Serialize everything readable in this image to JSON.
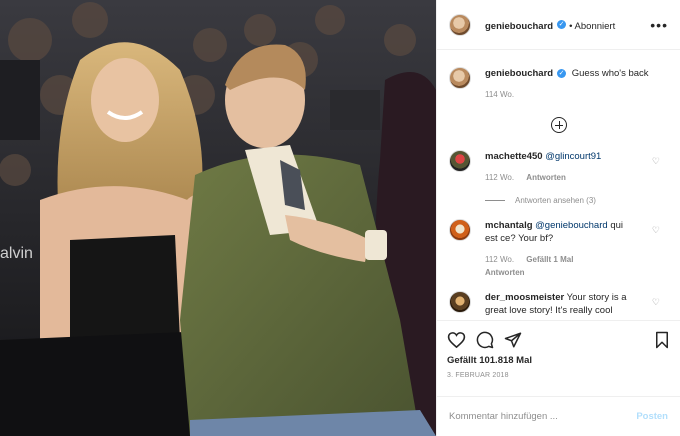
{
  "post": {
    "author": "geniebouchard",
    "follow_label": "Abonniert",
    "more_label": "•••",
    "caption_text": "Guess who's back",
    "caption_age": "114 Wo.",
    "likes": "Gefällt 101.818 Mal",
    "date": "3. FEBRUAR 2018",
    "verified_glyph": "✓",
    "photo_text": "alvin"
  },
  "comments": [
    {
      "user": "machette450",
      "mention": "@glincourt91",
      "text": "",
      "age": "112 Wo.",
      "reply_label": "Antworten",
      "likes": "",
      "view_replies": "Antworten ansehen (3)"
    },
    {
      "user": "mchantalg",
      "mention": "@geniebouchard",
      "text": "qui est ce? Your bf?",
      "age": "112 Wo.",
      "likes": "Gefällt 1 Mal",
      "reply_label": "Antworten"
    },
    {
      "user": "der_moosmeister",
      "mention": "",
      "text": "Your story is a great love story! It's really cool",
      "age": "",
      "likes": "",
      "reply_label": ""
    }
  ],
  "composer": {
    "placeholder": "Kommentar hinzufügen ...",
    "post_label": "Posten"
  },
  "icons": {
    "heart": "♡",
    "like": "heart-outline-icon",
    "comment": "comment-bubble-icon",
    "share": "paper-plane-icon",
    "save": "bookmark-icon",
    "add": "plus-circle-icon",
    "more": "ellipsis-icon"
  },
  "colors": {
    "link": "#00376b",
    "muted": "#8e8e8e",
    "verified": "#3897f0",
    "post_button": "#b2dffc"
  }
}
